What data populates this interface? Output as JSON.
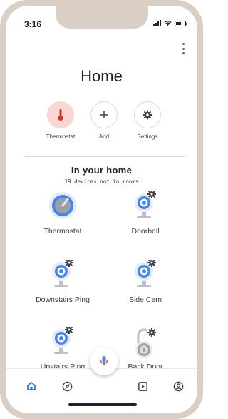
{
  "status": {
    "time": "3:16"
  },
  "header": {
    "title": "Home",
    "menu_icon": "more-vert-icon"
  },
  "actions": [
    {
      "label": "Thermostat",
      "icon": "thermometer-icon"
    },
    {
      "label": "Add",
      "icon": "plus-icon"
    },
    {
      "label": "Settings",
      "icon": "gear-icon"
    }
  ],
  "section": {
    "title": "In your home",
    "subtitle": "19 devices not in rooms"
  },
  "devices": [
    {
      "label": "Thermostat",
      "icon": "thermostat-device-icon"
    },
    {
      "label": "Doorbell",
      "icon": "camera-device-icon"
    },
    {
      "label": "Downstairs Ping",
      "icon": "camera-device-icon"
    },
    {
      "label": "Side Cam",
      "icon": "camera-device-icon"
    },
    {
      "label": "Upstairs Ping",
      "icon": "camera-device-icon"
    },
    {
      "label": "Back Door",
      "icon": "lock-device-icon"
    }
  ],
  "colors": {
    "accent_blue": "#4285f4",
    "thermostat_red": "#d93025",
    "thermostat_bg": "#f6d7d3",
    "mic_red": "#ea4335"
  },
  "bottom_nav": [
    {
      "icon": "home-icon"
    },
    {
      "icon": "compass-icon"
    },
    {
      "icon": "media-icon"
    },
    {
      "icon": "account-icon"
    }
  ]
}
